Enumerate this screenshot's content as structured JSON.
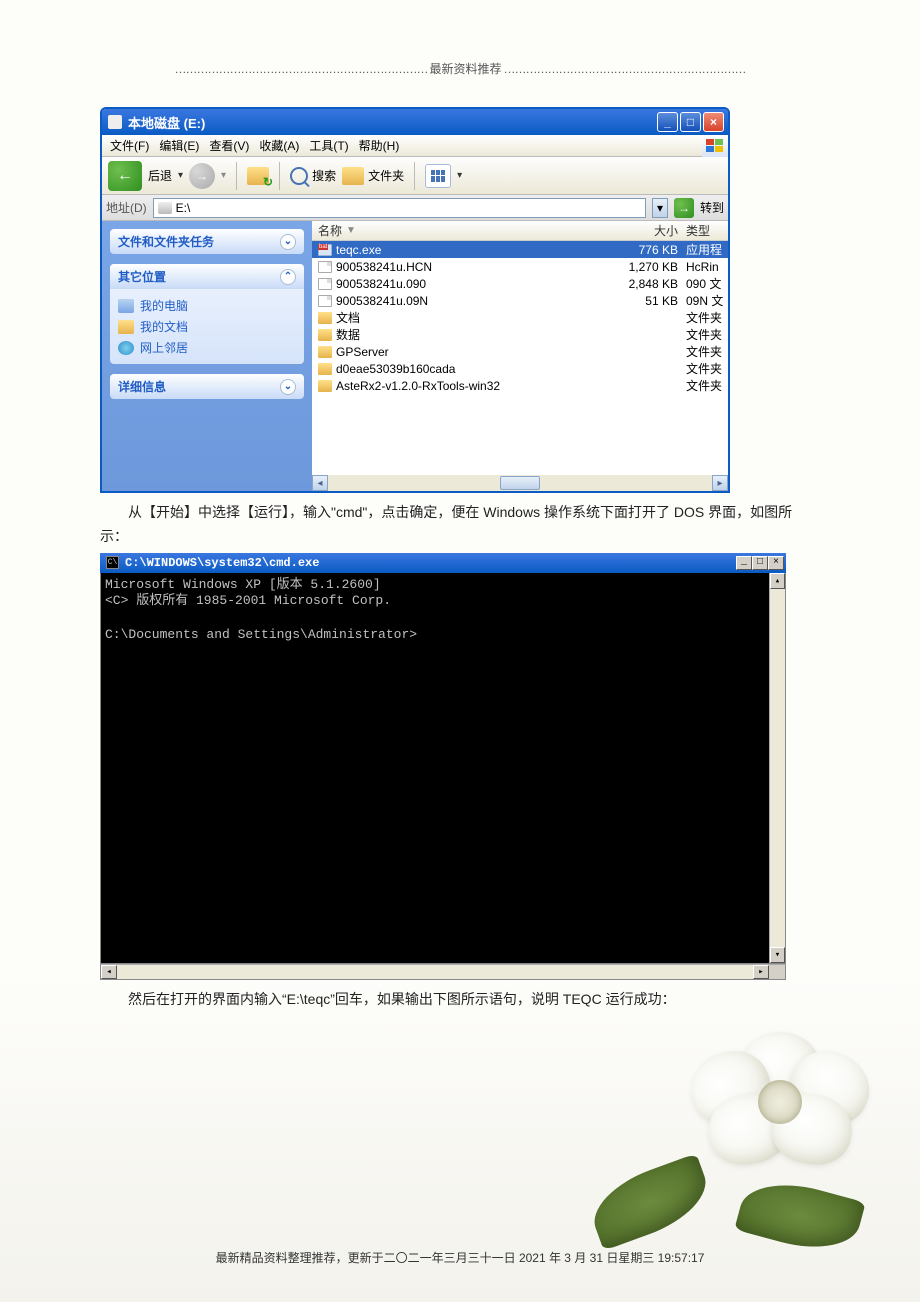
{
  "header": {
    "label": "最新资料推荐"
  },
  "explorer": {
    "title": "本地磁盘 (E:)",
    "menus": [
      "文件(F)",
      "编辑(E)",
      "查看(V)",
      "收藏(A)",
      "工具(T)",
      "帮助(H)"
    ],
    "toolbar": {
      "back": "后退",
      "search": "搜索",
      "folders": "文件夹"
    },
    "address": {
      "label": "地址(D)",
      "path": "E:\\",
      "go": "转到"
    },
    "sidebar": {
      "tasks_title": "文件和文件夹任务",
      "other_title": "其它位置",
      "places": [
        "我的电脑",
        "我的文档",
        "网上邻居"
      ],
      "details_title": "详细信息"
    },
    "cols": {
      "name": "名称",
      "size": "大小",
      "type": "类型"
    },
    "files": [
      {
        "name": "teqc.exe",
        "size": "776 KB",
        "type": "应用程",
        "icon": "exe",
        "sel": true
      },
      {
        "name": "900538241u.HCN",
        "size": "1,270 KB",
        "type": "HcRin",
        "icon": "doc"
      },
      {
        "name": "900538241u.090",
        "size": "2,848 KB",
        "type": "090 文",
        "icon": "doc"
      },
      {
        "name": "900538241u.09N",
        "size": "51 KB",
        "type": "09N 文",
        "icon": "doc"
      },
      {
        "name": "文档",
        "size": "",
        "type": "文件夹",
        "icon": "folder"
      },
      {
        "name": "数据",
        "size": "",
        "type": "文件夹",
        "icon": "folder"
      },
      {
        "name": "GPServer",
        "size": "",
        "type": "文件夹",
        "icon": "folder"
      },
      {
        "name": "d0eae53039b160cada",
        "size": "",
        "type": "文件夹",
        "icon": "folder"
      },
      {
        "name": "AsteRx2-v1.2.0-RxTools-win32",
        "size": "",
        "type": "文件夹",
        "icon": "folder"
      }
    ]
  },
  "text1": "从【开始】中选择【运行】，输入\"cmd\"，点击确定，便在 Windows 操作系统下面打开了 DOS 界面，如图所示：",
  "cmd": {
    "title": "C:\\WINDOWS\\system32\\cmd.exe",
    "lines": "Microsoft Windows XP [版本 5.1.2600]\n<C> 版权所有 1985-2001 Microsoft Corp.\n\nC:\\Documents and Settings\\Administrator>"
  },
  "text2": "然后在打开的界面内输入“E:\\teqc”回车，如果输出下图所示语句，说明 TEQC 运行成功：",
  "footer": "最新精品资料整理推荐，更新于二〇二一年三月三十一日 2021 年 3 月 31 日星期三 19:57:17"
}
